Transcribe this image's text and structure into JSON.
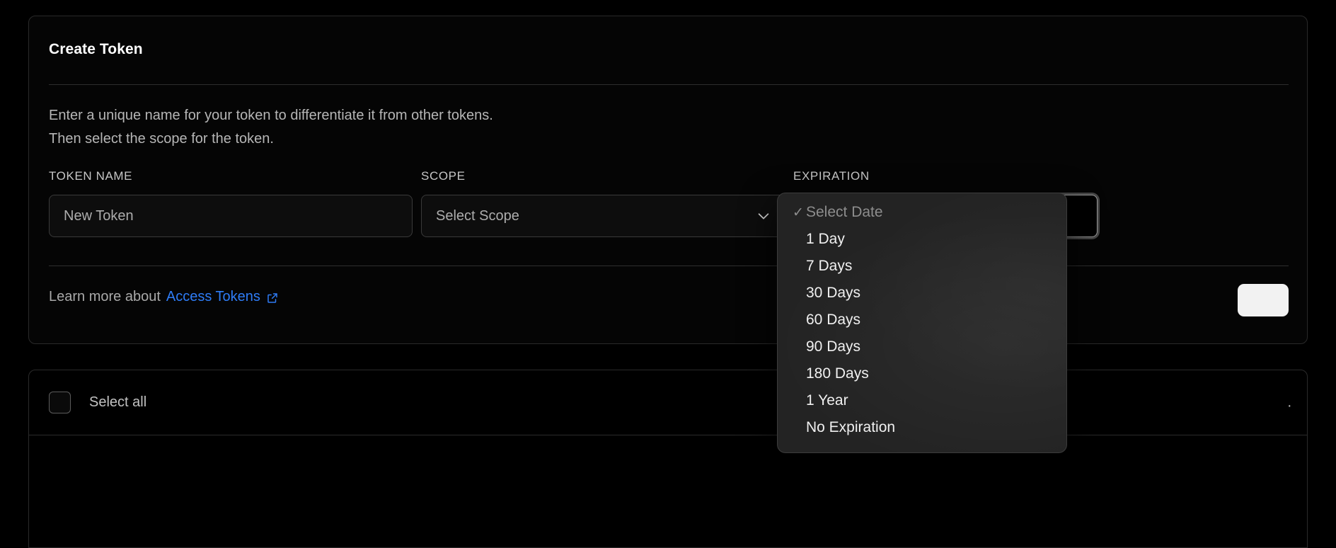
{
  "card": {
    "title": "Create Token",
    "description_line1": "Enter a unique name for your token to differentiate it from other tokens.",
    "description_line2": "Then select the scope for the token.",
    "learn_prefix": "Learn more about",
    "learn_link": "Access Tokens",
    "external_link_icon": "external-link-icon"
  },
  "fields": {
    "token_name": {
      "label": "TOKEN NAME",
      "placeholder": "New Token",
      "value": ""
    },
    "scope": {
      "label": "SCOPE",
      "placeholder": "Select Scope",
      "value": "",
      "chevron_icon": "chevron-down-icon"
    },
    "expiration": {
      "label": "EXPIRATION",
      "placeholder": "",
      "value": ""
    }
  },
  "expiration_menu": {
    "options": [
      {
        "label": "Select Date",
        "selected": true,
        "dim": true
      },
      {
        "label": "1 Day",
        "selected": false,
        "dim": false
      },
      {
        "label": "7 Days",
        "selected": false,
        "dim": false
      },
      {
        "label": "30 Days",
        "selected": false,
        "dim": false
      },
      {
        "label": "60 Days",
        "selected": false,
        "dim": false
      },
      {
        "label": "90 Days",
        "selected": false,
        "dim": false
      },
      {
        "label": "180 Days",
        "selected": false,
        "dim": false
      },
      {
        "label": "1 Year",
        "selected": false,
        "dim": false
      },
      {
        "label": "No Expiration",
        "selected": false,
        "dim": false
      }
    ],
    "check_glyph": "✓"
  },
  "scopes_panel": {
    "select_all_label": "Select all",
    "row_trailing_text": "."
  },
  "colors": {
    "background": "#000000",
    "card_border": "#2a2a2a",
    "link_blue": "#2e7cf6",
    "menu_background": "#232323",
    "text_primary": "#ffffff",
    "text_secondary": "#b6b6b6",
    "text_muted": "#8d8d8d"
  }
}
